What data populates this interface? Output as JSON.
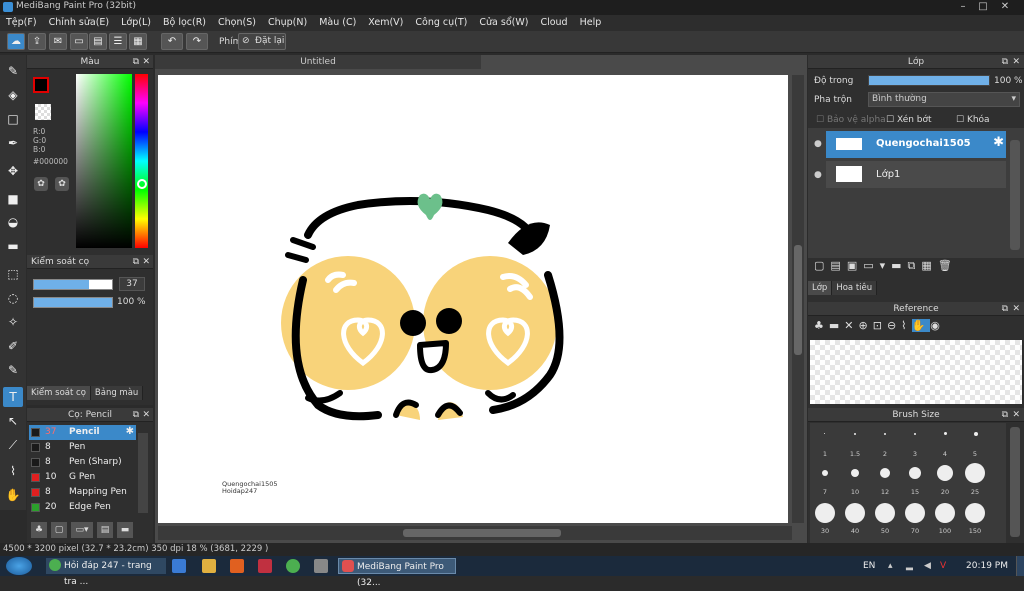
{
  "app": {
    "title": "MediBang Paint Pro (32bit)"
  },
  "menu": [
    "Tệp(F)",
    "Chỉnh sửa(E)",
    "Lớp(L)",
    "Bộ lọc(R)",
    "Chọn(S)",
    "Chụp(N)",
    "Màu (C)",
    "Xem(V)",
    "Công cụ(T)",
    "Cửa sổ(W)",
    "Cloud",
    "Help"
  ],
  "toolbar": {
    "key_label": "Phím",
    "reset_label": "Đặt lại"
  },
  "color_panel": {
    "title": "Màu",
    "r": "R:0",
    "g": "G:0",
    "b": "B:0",
    "hex": "#000000"
  },
  "brush_control": {
    "title": "Kiểm soát cọ",
    "size": "37",
    "opacity": "100 %",
    "tab1": "Kiểm soát cọ",
    "tab2": "Bảng màu",
    "size_fill": 0.7,
    "opacity_fill": 1.0
  },
  "brush_panel": {
    "title": "Cọ: Pencil",
    "items": [
      {
        "size": "37",
        "name": "Pencil",
        "color": "#1a1a1a",
        "selected": true
      },
      {
        "size": "8",
        "name": "Pen",
        "color": "#1a1a1a"
      },
      {
        "size": "8",
        "name": "Pen (Sharp)",
        "color": "#1a1a1a"
      },
      {
        "size": "10",
        "name": "G Pen",
        "color": "#e02020"
      },
      {
        "size": "8",
        "name": "Mapping Pen",
        "color": "#e02020"
      },
      {
        "size": "20",
        "name": "Edge Pen",
        "color": "#2ca02c"
      }
    ]
  },
  "document": {
    "tab": "Untitled",
    "caption1": "Quengochai1505",
    "caption2": "Hoidap247"
  },
  "layer_panel": {
    "title": "Lớp",
    "opacity_label": "Độ trong",
    "opacity_value": "100 %",
    "opacity_fill": 1.0,
    "blend_label": "Pha trộn",
    "blend_value": "Bình thường",
    "protect_alpha": "Bảo vệ alpha",
    "clipping": "Xén bớt",
    "lock": "Khóa",
    "layers": [
      {
        "name": "Quengochai1505",
        "selected": true
      },
      {
        "name": "Lớp1",
        "selected": false
      }
    ],
    "tab1": "Lớp",
    "tab2": "Hoa tiêu"
  },
  "reference_panel": {
    "title": "Reference"
  },
  "brush_size_panel": {
    "title": "Brush Size",
    "labels": [
      "1",
      "1.5",
      "2",
      "3",
      "4",
      "5",
      "7",
      "10",
      "12",
      "15",
      "20",
      "25",
      "30",
      "40",
      "50",
      "70",
      "100",
      "150"
    ]
  },
  "status": {
    "text": "4500 * 3200 pixel  (32.7 * 23.2cm)  350 dpi  18 %  (3681, 2229 )"
  },
  "taskbar": {
    "task1": "Hỏi đáp 247 - trang tra ...",
    "task2": "MediBang Paint Pro (32...",
    "lang": "EN",
    "time": "20:19 PM"
  },
  "colors": {
    "accent": "#3b89c9",
    "skin": "#f8d37a",
    "leaf": "#6cc08b"
  }
}
